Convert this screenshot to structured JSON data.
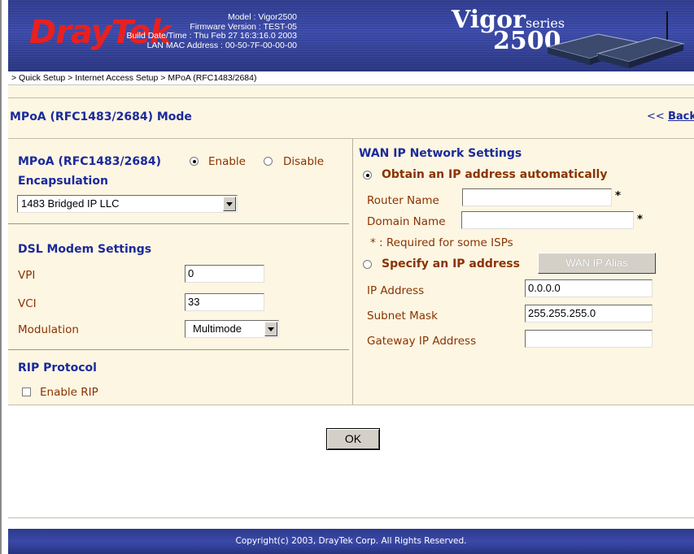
{
  "header": {
    "brand": "DrayTek",
    "model_line": "Model : Vigor2500",
    "firmware_line": "Firmware Version : TEST-05",
    "build_line": "Build Date/Time : Thu Feb 27 16:3:16.0 2003",
    "mac_line": "LAN MAC Address : 00-50-7F-00-00-00",
    "product_vigor": "Vigor",
    "product_series": "series",
    "product_number": "2500"
  },
  "breadcrumb": "> Quick Setup > Internet Access Setup > MPoA (RFC1483/2684)",
  "page_title": "MPoA (RFC1483/2684) Mode",
  "back_link": {
    "arrows": "<<",
    "label": "Back"
  },
  "left": {
    "mpoa_label": "MPoA (RFC1483/2684)",
    "enable_label": "Enable",
    "disable_label": "Disable",
    "enabled": true,
    "encapsulation_title": "Encapsulation",
    "encapsulation_value": "1483 Bridged IP LLC",
    "dsl_title": "DSL Modem Settings",
    "vpi_label": "VPI",
    "vpi_value": "0",
    "vci_label": "VCI",
    "vci_value": "33",
    "modulation_label": "Modulation",
    "modulation_value": "Multimode",
    "rip_title": "RIP Protocol",
    "enable_rip_label": "Enable RIP",
    "rip_enabled": false
  },
  "right": {
    "wan_title": "WAN IP Network Settings",
    "obtain_auto_label": "Obtain an IP address automatically",
    "obtain_auto_selected": true,
    "router_name_label": "Router Name",
    "router_name_value": "",
    "domain_name_label": "Domain Name",
    "domain_name_value": "",
    "required_mark": "*",
    "required_note": "* : Required for some ISPs",
    "specify_label": "Specify an IP address",
    "wan_alias_button": "WAN IP Alias",
    "ip_address_label": "IP Address",
    "ip_address_value": "0.0.0.0",
    "subnet_label": "Subnet Mask",
    "subnet_value": "255.255.255.0",
    "gateway_label": "Gateway IP Address",
    "gateway_value": ""
  },
  "ok_button": "OK",
  "footer": "Copyright(c) 2003, DrayTek Corp. All Rights Reserved.",
  "colors": {
    "header_blue": "#2d3a8c",
    "title_blue": "#1a2a9c",
    "label_brown": "#8a3300",
    "logo_red": "#e82020",
    "panel_cream": "#fdf6e2"
  }
}
